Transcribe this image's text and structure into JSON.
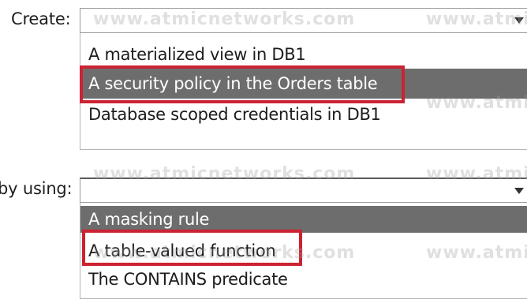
{
  "create": {
    "label": "Create:",
    "selected_value": "",
    "options": [
      "A materialized view in DB1",
      "A security policy in the Orders table",
      "Database scoped credentials in DB1"
    ],
    "highlighted_index": 1,
    "marked_answer_index": 1
  },
  "using": {
    "label": "by using:",
    "selected_value": "",
    "options": [
      "A masking rule",
      "A table-valued function",
      "The CONTAINS predicate"
    ],
    "highlighted_index": 0,
    "marked_answer_index": 1
  },
  "watermark": {
    "text": "www.atmicnetworks.com",
    "text_right": "www.atmi"
  },
  "colors": {
    "highlight_bg": "#6d6d6d",
    "answer_border": "#cc2233"
  },
  "icons": {
    "dropdown_arrow": "chevron-down-icon"
  }
}
